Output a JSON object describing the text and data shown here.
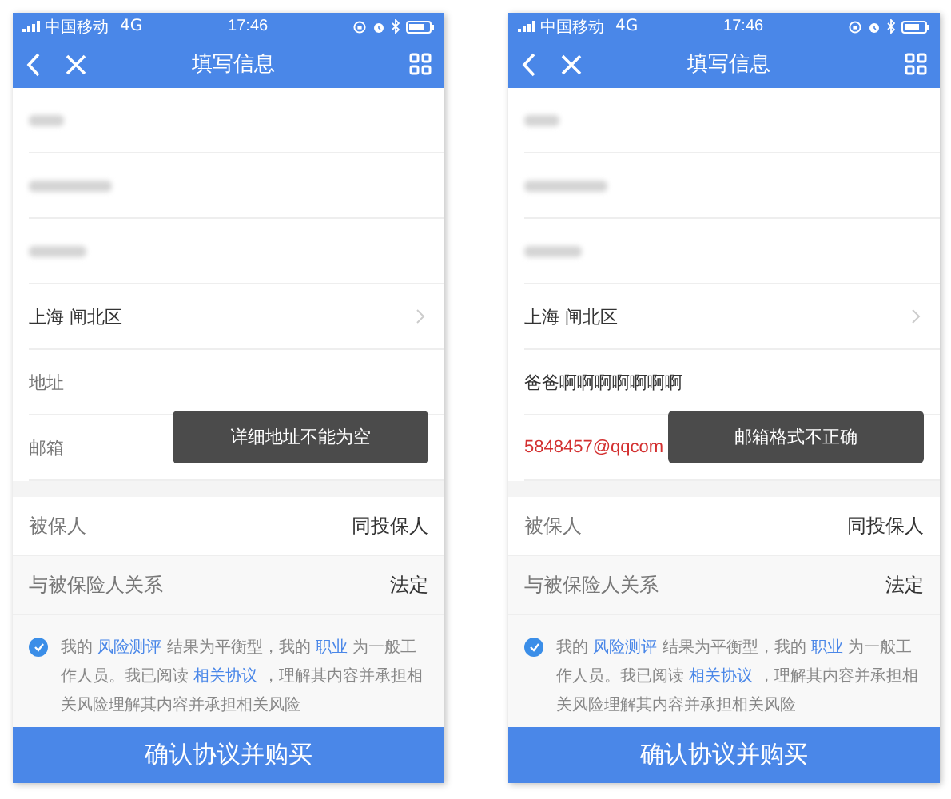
{
  "phones": [
    {
      "status_bar": {
        "carrier": "中国移动",
        "network": "4G",
        "time": "17:46"
      },
      "nav": {
        "title": "填写信息"
      },
      "fields": [
        {
          "kind": "redacted"
        },
        {
          "kind": "redacted"
        },
        {
          "kind": "redacted"
        },
        {
          "kind": "select",
          "value": "上海 闸北区"
        },
        {
          "kind": "placeholder",
          "placeholder": "地址"
        },
        {
          "kind": "placeholder",
          "placeholder": "邮箱"
        }
      ],
      "toast": "详细地址不能为空",
      "insured": {
        "label": "被保人",
        "value": "同投保人"
      },
      "relation": {
        "label": "与被保险人关系",
        "value": "法定"
      },
      "agreement": {
        "checked": true,
        "parts": [
          {
            "kind": "text",
            "text": "我的 "
          },
          {
            "kind": "link",
            "text": "风险测评"
          },
          {
            "kind": "text",
            "text": " 结果为平衡型，我的 "
          },
          {
            "kind": "link",
            "text": "职业"
          },
          {
            "kind": "text",
            "text": " 为一般工作人员。我已阅读 "
          },
          {
            "kind": "link",
            "text": "相关协议"
          },
          {
            "kind": "text",
            "text": " ，理解其内容并承担相关风险理解其内容并承担相关风险"
          }
        ]
      },
      "button": "确认协议并购买"
    },
    {
      "status_bar": {
        "carrier": "中国移动",
        "network": "4G",
        "time": "17:46"
      },
      "nav": {
        "title": "填写信息"
      },
      "fields": [
        {
          "kind": "redacted"
        },
        {
          "kind": "redacted"
        },
        {
          "kind": "redacted"
        },
        {
          "kind": "select",
          "value": "上海 闸北区"
        },
        {
          "kind": "value",
          "value": "爸爸啊啊啊啊啊啊啊"
        },
        {
          "kind": "error",
          "value": "5848457@qqcom"
        }
      ],
      "toast": "邮箱格式不正确",
      "insured": {
        "label": "被保人",
        "value": "同投保人"
      },
      "relation": {
        "label": "与被保险人关系",
        "value": "法定"
      },
      "agreement": {
        "checked": true,
        "parts": [
          {
            "kind": "text",
            "text": "我的 "
          },
          {
            "kind": "link",
            "text": "风险测评"
          },
          {
            "kind": "text",
            "text": " 结果为平衡型，我的 "
          },
          {
            "kind": "link",
            "text": "职业"
          },
          {
            "kind": "text",
            "text": " 为一般工作人员。我已阅读 "
          },
          {
            "kind": "link",
            "text": "相关协议"
          },
          {
            "kind": "text",
            "text": " ，理解其内容并承担相关风险理解其内容并承担相关风险"
          }
        ]
      },
      "button": "确认协议并购买"
    }
  ]
}
